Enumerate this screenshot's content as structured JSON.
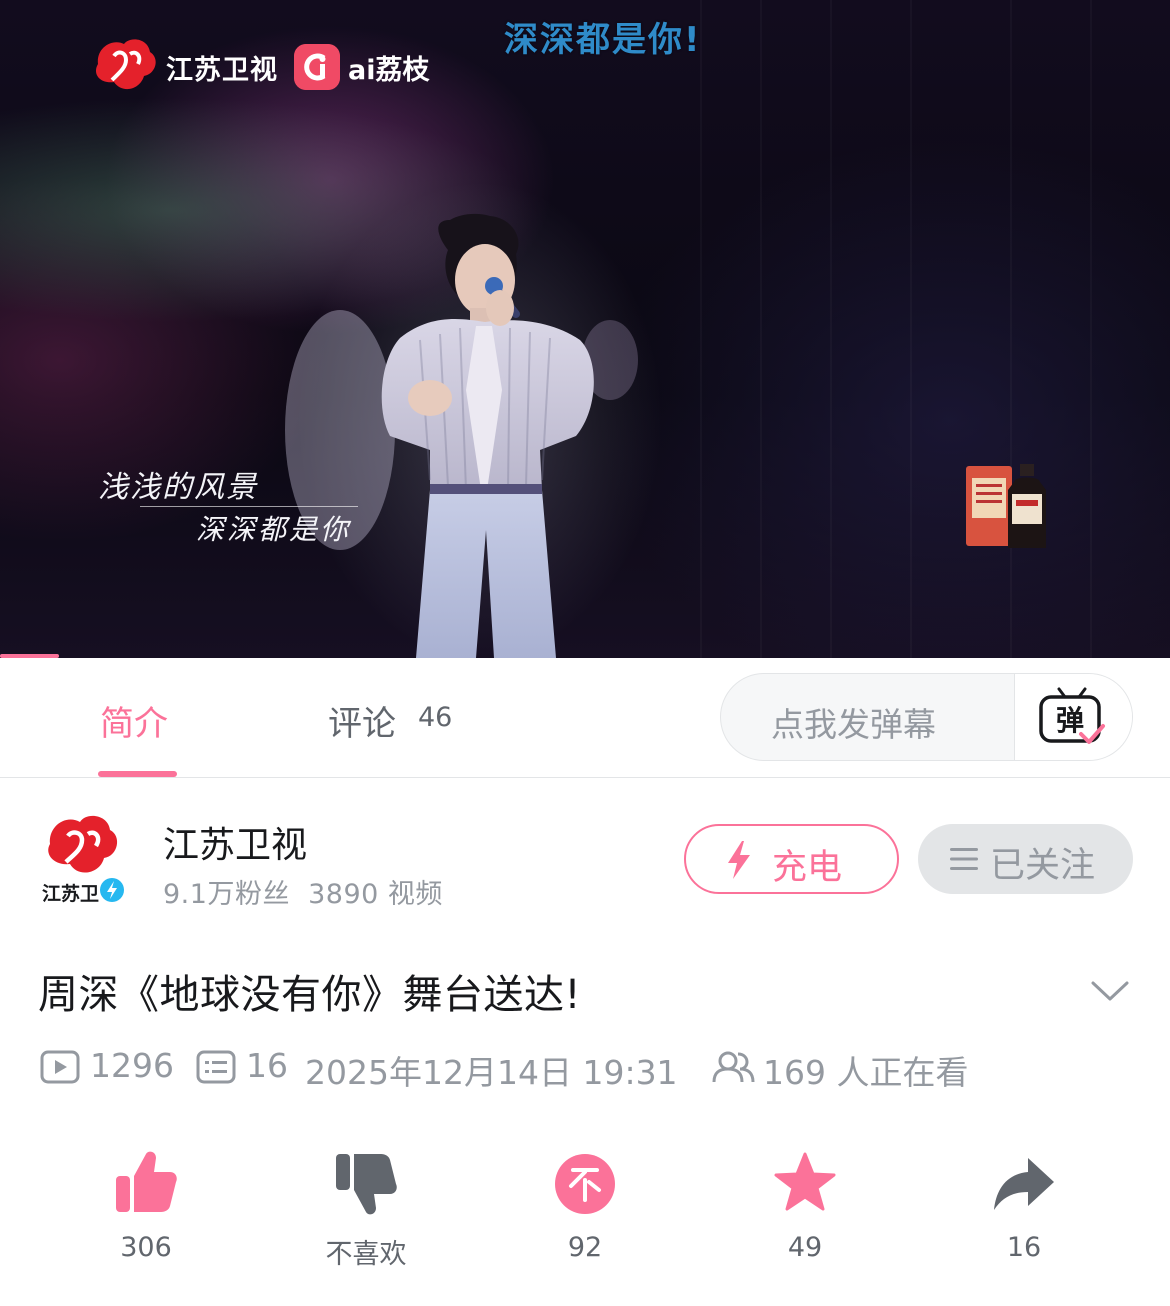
{
  "video": {
    "top_caption": "深深都是你!",
    "channel_logo_text": "江苏卫视",
    "platform_logo_text": "ai荔枝",
    "lyrics": {
      "line1": "浅浅的风景",
      "line2": "深深都是你"
    },
    "progress_fraction": 0.05
  },
  "tabs": {
    "intro_label": "简介",
    "comments_label": "评论",
    "comments_count": "46",
    "danmaku_placeholder": "点我发弹幕",
    "danmaku_button_glyph": "弹"
  },
  "uploader": {
    "name": "江苏卫视",
    "avatar_text": "江苏卫",
    "fans": "9.1万粉丝",
    "videos": "3890 视频",
    "charge_label": "充电",
    "followed_label": "已关注"
  },
  "video_info": {
    "title": "周深《地球没有你》舞台送达!",
    "plays": "1296",
    "danmaku_count": "16",
    "publish_time": "2025年12月14日 19:31",
    "watching_now": "169 人正在看"
  },
  "actions": {
    "like_count": "306",
    "dislike_label": "不喜欢",
    "coin_count": "92",
    "favorite_count": "49",
    "share_count": "16"
  },
  "colors": {
    "accent": "#fb7299",
    "text_primary": "#18191c",
    "text_secondary": "#9499a0",
    "icon_gray": "#61666d",
    "caption_blue": "#2f8bc9"
  }
}
